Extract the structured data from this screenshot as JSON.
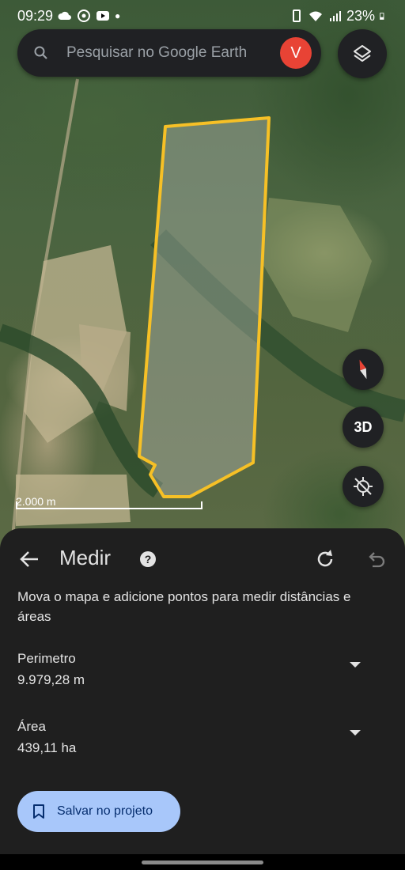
{
  "status_bar": {
    "time": "09:29",
    "battery": "23%"
  },
  "search": {
    "placeholder": "Pesquisar no Google Earth",
    "avatar_letter": "V"
  },
  "map_controls": {
    "tilt_label": "3D"
  },
  "scale": {
    "label": "2.000 m"
  },
  "measure_panel": {
    "title": "Medir",
    "instructions": "Mova o mapa e adicione pontos para medir distâncias e áreas",
    "perimeter": {
      "label": "Perimetro",
      "value": "9.979,28 m"
    },
    "area": {
      "label": "Área",
      "value": "439,11 ha"
    },
    "save_label": "Salvar no projeto"
  },
  "colors": {
    "polygon_outline": "#f6c026",
    "save_button_bg": "#a8c7fa",
    "avatar_bg": "#e84335",
    "panel_bg": "#1f1f1f"
  }
}
